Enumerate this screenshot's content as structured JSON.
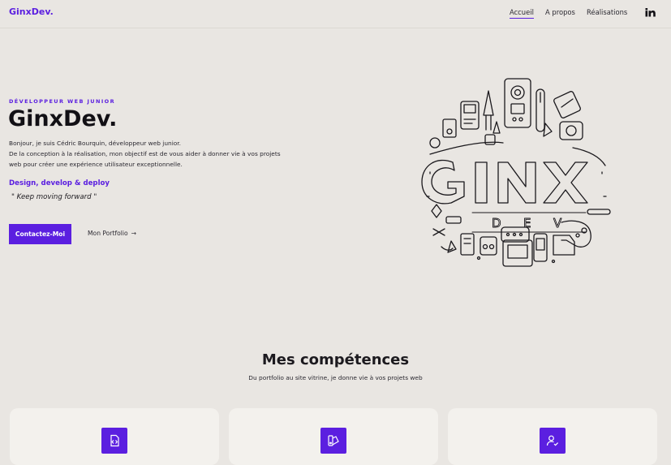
{
  "header": {
    "logo": "GinxDev.",
    "nav": [
      {
        "label": "Accueil",
        "active": true
      },
      {
        "label": "A propos",
        "active": false
      },
      {
        "label": "Réalisations",
        "active": false
      }
    ],
    "social_icon": "linkedin-icon"
  },
  "hero": {
    "eyebrow": "DÉVELOPPEUR WEB JUNIOR",
    "title": "GinxDev.",
    "intro_line1": "Bonjour, je suis Cédric Bourquin, développeur web junior.",
    "intro_line2": "De la conception à la réalisation, mon objectif est de vous aider à donner vie à vos projets web pour créer une expérience utilisateur exceptionnelle.",
    "tagline": "Design, develop & deploy",
    "motto": "\" Keep moving forward \"",
    "cta_primary": "Contactez-Moi",
    "cta_secondary": "Mon Portfolio",
    "cta_secondary_icon": "arrow-right-icon",
    "illustration_letters": "GINX",
    "illustration_sub": "D E V"
  },
  "skills": {
    "title": "Mes compétences",
    "subtitle": "Du portfolio au site vitrine, je donne vie à vos projets web",
    "cards": [
      {
        "icon": "code-file-icon"
      },
      {
        "icon": "design-icon"
      },
      {
        "icon": "user-check-icon"
      }
    ]
  },
  "colors": {
    "accent": "#5b1fe0",
    "background": "#e9e6e2",
    "card": "#f3f1ed"
  }
}
